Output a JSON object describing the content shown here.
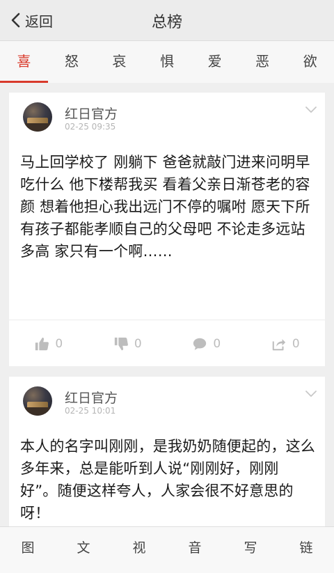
{
  "header": {
    "back_label": "返回",
    "title": "总榜"
  },
  "tabs": [
    "喜",
    "怒",
    "哀",
    "惧",
    "爱",
    "恶",
    "欲"
  ],
  "active_tab": 0,
  "posts": [
    {
      "author": "红日官方",
      "time": "02-25 09:35",
      "content": "马上回学校了 刚躺下 爸爸就敲门进来问明早吃什么 他下楼帮我买 看着父亲日渐苍老的容颜 想着他担心我出远门不停的嘱咐 愿天下所有孩子都能孝顺自己的父母吧 不论走多远站多高 家只有一个啊……",
      "likes": "0",
      "dislikes": "0",
      "comments": "0",
      "shares": "0"
    },
    {
      "author": "红日官方",
      "time": "02-25 10:01",
      "content": "本人的名字叫刚刚，是我奶奶随便起的，这么多年来，总是能听到人说“刚刚好，刚刚好”。随便这样夸人，人家会很不好意思的呀！"
    }
  ],
  "bottom_nav": [
    "图",
    "文",
    "视",
    "音",
    "写",
    "链"
  ],
  "colors": {
    "accent": "#d93a2b",
    "icon_gray": "#bdbdbd"
  },
  "icons": [
    "chevron-left-icon",
    "chevron-down-icon",
    "thumbs-up-icon",
    "thumbs-down-icon",
    "comment-icon",
    "share-icon"
  ]
}
